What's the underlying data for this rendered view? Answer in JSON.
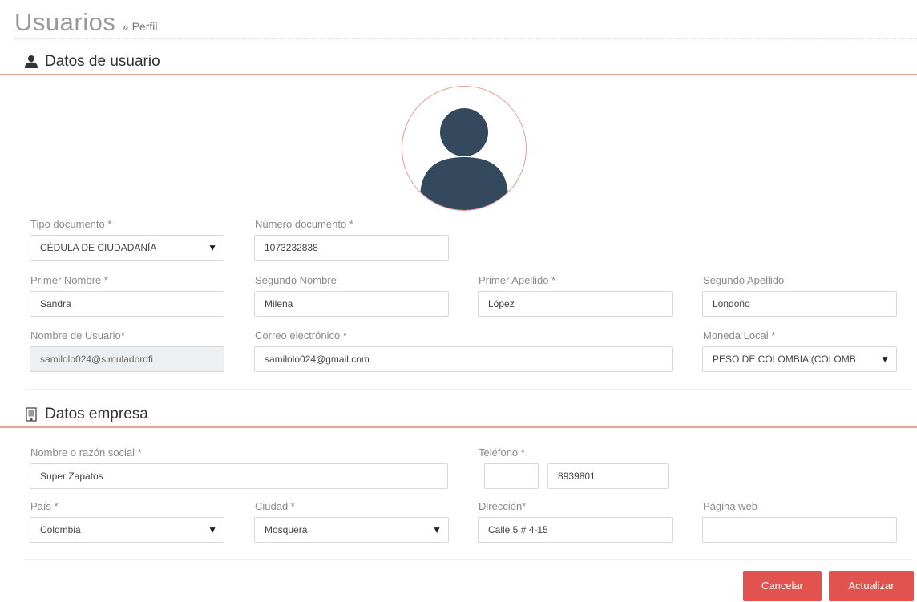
{
  "title": {
    "main": "Usuarios",
    "separator": "»",
    "sub": "Perfil"
  },
  "user_section": {
    "title": "Datos de usuario",
    "icon": "user-icon",
    "avatar_icon": "avatar-placeholder",
    "fields": {
      "tipo_documento": {
        "label": "Tipo documento *",
        "value": "CÉDULA DE CIUDADANÍA"
      },
      "numero_documento": {
        "label": "Número documento *",
        "value": "1073232838"
      },
      "primer_nombre": {
        "label": "Primer Nombre *",
        "value": "Sandra"
      },
      "segundo_nombre": {
        "label": "Segundo Nombre",
        "value": "Milena"
      },
      "primer_apellido": {
        "label": "Primer Apellido *",
        "value": "López"
      },
      "segundo_apellido": {
        "label": "Segundo Apellido",
        "value": "Londoño"
      },
      "nombre_usuario": {
        "label": "Nombre de Usuario*",
        "value": "samilolo024@simuladordfi"
      },
      "correo": {
        "label": "Correo electrónico *",
        "value": "samilolo024@gmail.com"
      },
      "moneda": {
        "label": "Moneda Local *",
        "value": "PESO DE COLOMBIA (COLOMB"
      }
    }
  },
  "company_section": {
    "title": "Datos empresa",
    "icon": "building-icon",
    "fields": {
      "razon_social": {
        "label": "Nombre o razón social *",
        "value": "Super Zapatos"
      },
      "telefono": {
        "label": "Teléfono *",
        "prefix": "",
        "value": "8939801"
      },
      "pais": {
        "label": "País *",
        "value": "Colombia"
      },
      "ciudad": {
        "label": "Ciudad *",
        "value": "Mosquera"
      },
      "direccion": {
        "label": "Dirección*",
        "value": "Calle 5 # 4-15"
      },
      "pagina_web": {
        "label": "Página web",
        "value": ""
      }
    }
  },
  "buttons": {
    "cancel": "Cancelar",
    "update": "Actualizar"
  },
  "colors": {
    "accent": "#e2534f",
    "divider": "#e8a298",
    "avatar": "#34495e"
  }
}
